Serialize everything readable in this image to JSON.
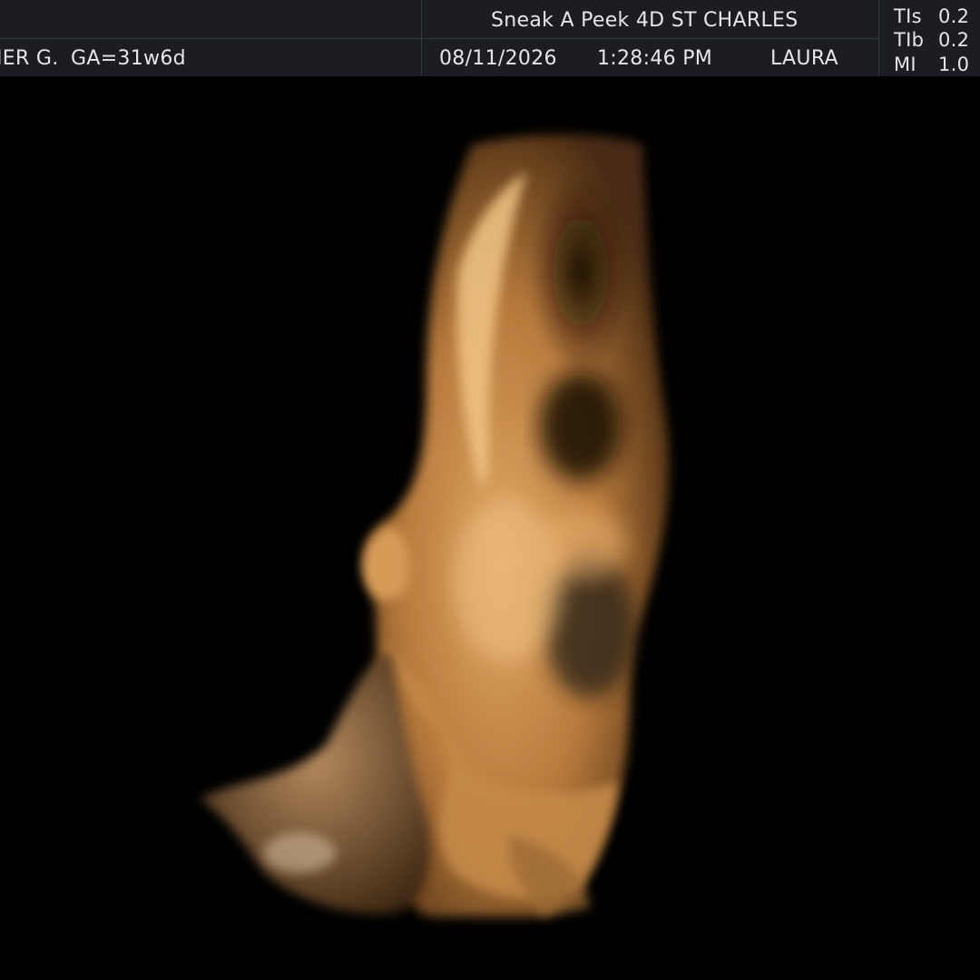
{
  "header": {
    "patient": "IER G.",
    "gestational_age": "GA=31w6d",
    "clinic": "Sneak A Peek 4D ST CHARLES",
    "date": "08/11/2026",
    "time": "1:28:46 PM",
    "operator": "LAURA",
    "indices": [
      {
        "label": "TIs",
        "value": "0.2"
      },
      {
        "label": "TIb",
        "value": "0.2"
      },
      {
        "label": "MI",
        "value": "1.0"
      }
    ]
  },
  "image": {
    "subject": "4D ultrasound render of fetal face in profile",
    "tint_color": "#c98a45",
    "highlight_color": "#f2c68a",
    "shadow_color": "#2a1a0c"
  }
}
